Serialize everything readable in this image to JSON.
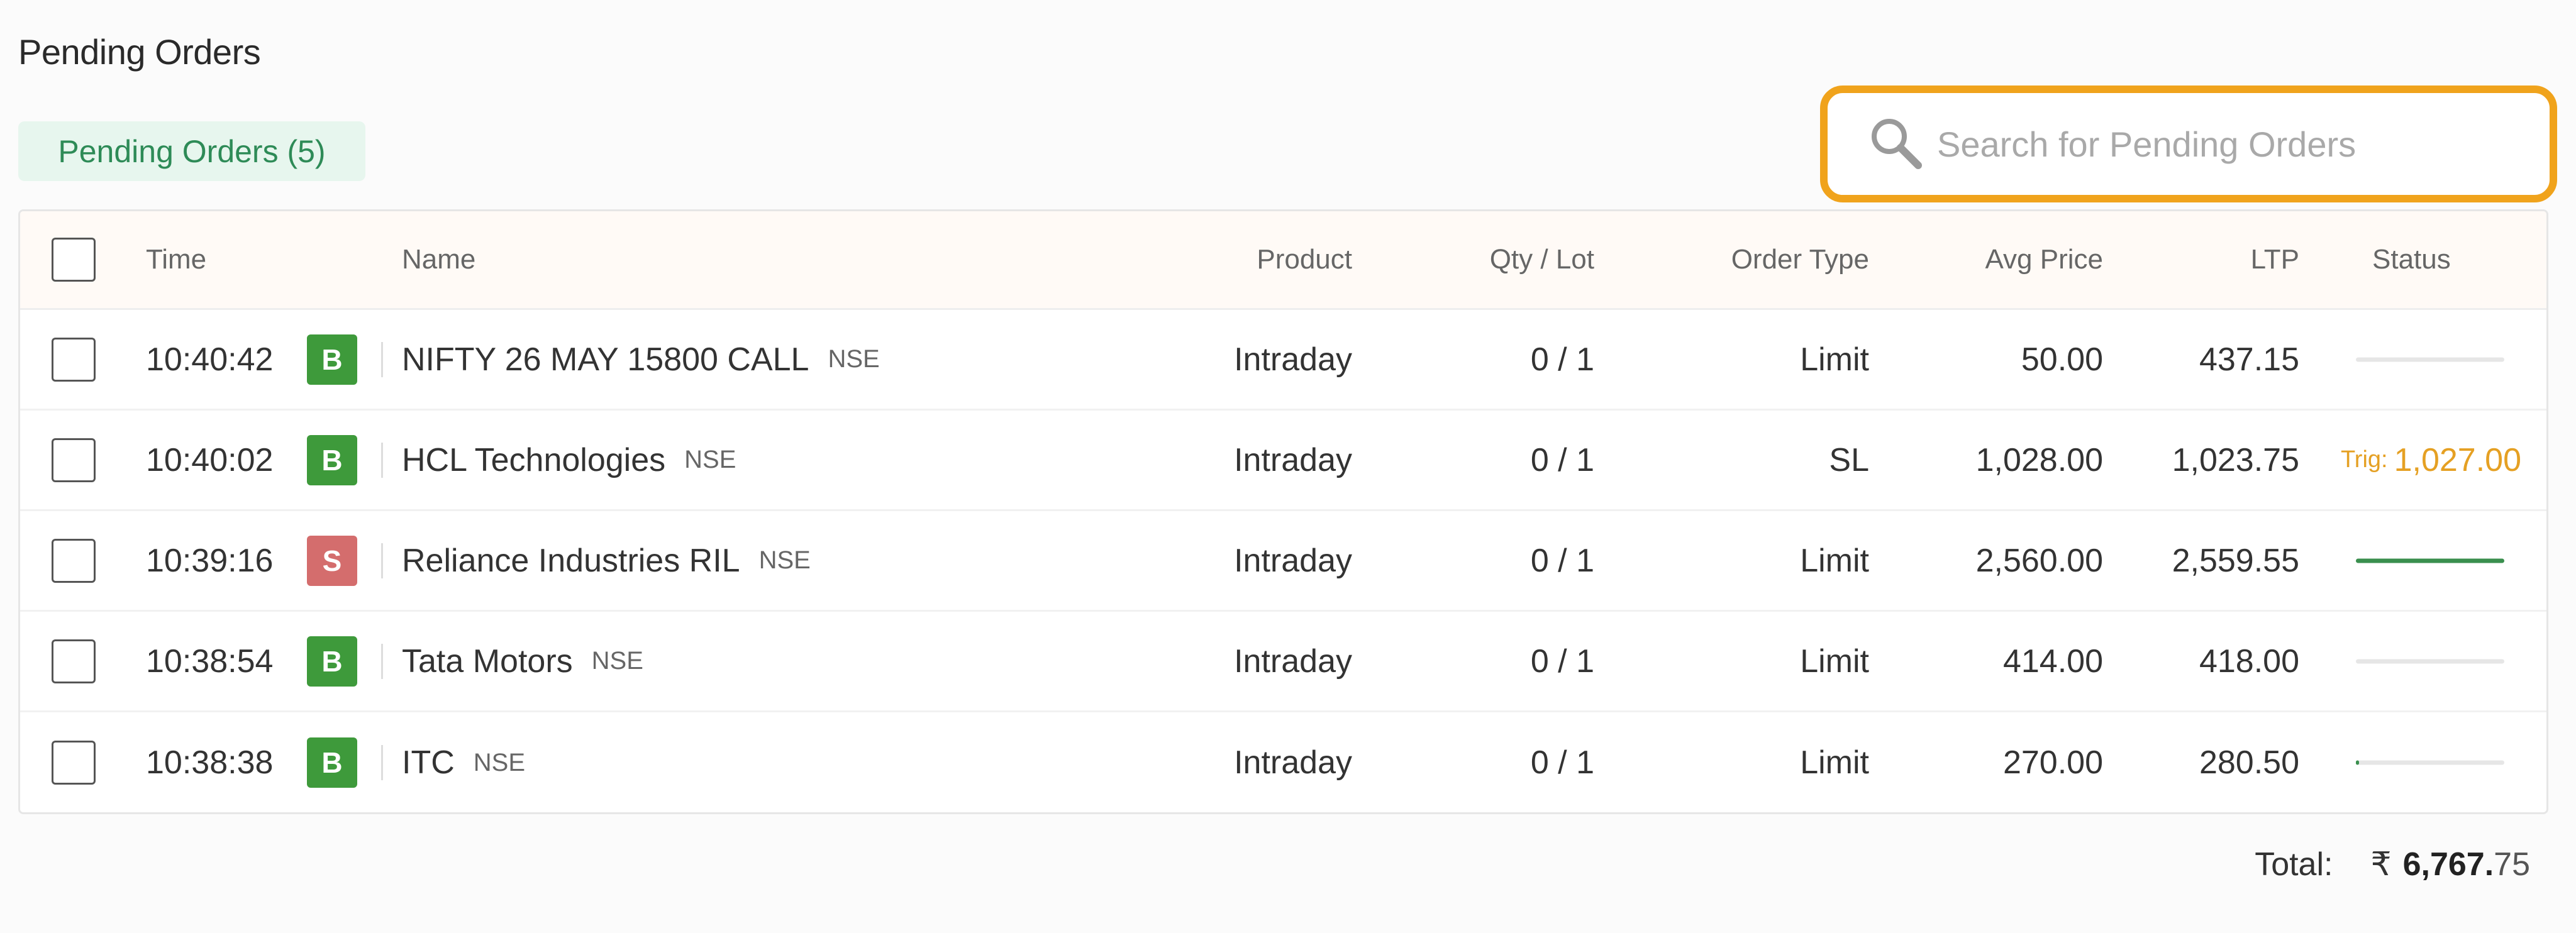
{
  "page": {
    "title": "Pending Orders",
    "tab_label": "Pending Orders (5)"
  },
  "search": {
    "placeholder": "Search for Pending Orders",
    "value": ""
  },
  "columns": {
    "time": "Time",
    "name": "Name",
    "product": "Product",
    "qty": "Qty / Lot",
    "order_type": "Order Type",
    "avg_price": "Avg Price",
    "ltp": "LTP",
    "status": "Status"
  },
  "orders": [
    {
      "time": "10:40:42",
      "side": "B",
      "name": "NIFTY 26 MAY 15800 CALL",
      "exchange": "NSE",
      "product": "Intraday",
      "qty": "0 / 1",
      "order_type": "Limit",
      "avg_price": "50.00",
      "ltp": "437.15",
      "status_progress": 0
    },
    {
      "time": "10:40:02",
      "side": "B",
      "name": "HCL Technologies",
      "exchange": "NSE",
      "product": "Intraday",
      "qty": "0 / 1",
      "order_type": "SL",
      "avg_price": "1,028.00",
      "ltp": "1,023.75",
      "trig_label": "Trig:",
      "trig_value": "1,027.00"
    },
    {
      "time": "10:39:16",
      "side": "S",
      "name": "Reliance Industries RIL",
      "exchange": "NSE",
      "product": "Intraday",
      "qty": "0 / 1",
      "order_type": "Limit",
      "avg_price": "2,560.00",
      "ltp": "2,559.55",
      "status_progress": 1
    },
    {
      "time": "10:38:54",
      "side": "B",
      "name": "Tata Motors",
      "exchange": "NSE",
      "product": "Intraday",
      "qty": "0 / 1",
      "order_type": "Limit",
      "avg_price": "414.00",
      "ltp": "418.00",
      "status_progress": 0
    },
    {
      "time": "10:38:38",
      "side": "B",
      "name": "ITC",
      "exchange": "NSE",
      "product": "Intraday",
      "qty": "0 / 1",
      "order_type": "Limit",
      "avg_price": "270.00",
      "ltp": "280.50",
      "status_progress": 0.02
    }
  ],
  "total": {
    "label": "Total:",
    "currency": "₹",
    "integer_part": "6,767.",
    "decimal_part": "75"
  },
  "colors": {
    "accent_search_border": "#f0a31c",
    "buy": "#3e9a3b",
    "sell": "#d46d6d",
    "trigger": "#e5a023",
    "progress": "#3a8f4e",
    "tab_bg": "#e7f6ee",
    "tab_text": "#2e8b57"
  },
  "icons": {
    "search": "search-icon"
  }
}
